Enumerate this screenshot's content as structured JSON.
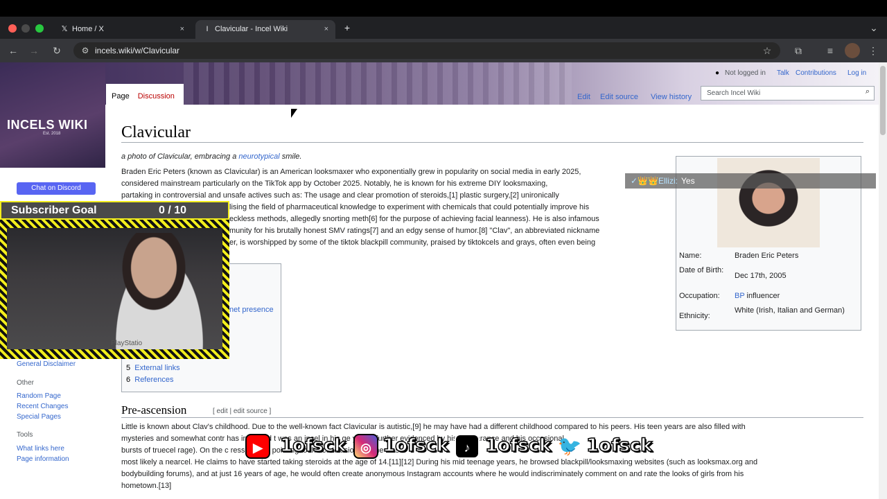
{
  "browser": {
    "tabs": [
      {
        "icon": "𝕏",
        "label": "Home / X",
        "close": "×"
      },
      {
        "icon": "I",
        "label": "Clavicular - Incel Wiki",
        "close": "×"
      }
    ],
    "new_tab": "+",
    "url": "incels.wiki/w/Clavicular",
    "toolbar_icons": {
      "back": "←",
      "forward": "→",
      "reload": "↻",
      "site_info": "⚙",
      "star": "☆",
      "extensions": "⧉",
      "media": "≡",
      "menu": "⋮",
      "tab_search": "⌄"
    }
  },
  "site": {
    "logo": "INCELS WIKI",
    "logo_sub": "Est. 2018",
    "discord": "Chat on Discord"
  },
  "page_tabs": {
    "page": "Page",
    "discussion": "Discussion"
  },
  "personal": {
    "not_logged_in": "Not logged in",
    "talk": "Talk",
    "contributions": "Contributions",
    "login": "Log in"
  },
  "views": {
    "edit": "Edit",
    "edit_source": "Edit source",
    "history": "View history"
  },
  "search": {
    "placeholder": "Search Incel Wiki",
    "icon": "⌕"
  },
  "article": {
    "title": "Clavicular",
    "caption": {
      "before": "a photo of Clavicular, embracing a ",
      "link": "neurotypical",
      "after": " smile."
    },
    "lines": [
      "Braden Eric Peters (known as Clavicular) is an American looksmaxer who exponentially grew in popularity on social media in early 2025,",
      "considered mainstream particularly on the TikTok app by October 2025. Notably, he is known for his extreme DIY looksmaxing,",
      "partaking in controversial and unsafe actives such as: The usage and clear promotion of steroids,[1] plastic surgery,[2] unironically",
      "lising the field of pharmaceutical knowledge to experiment with chemicals that could potentially improve his",
      "eckless methods, allegedly snorting meth[6] for the purpose of achieving facial leanness). He is also infamous",
      "munity for his brutally honest SMV ratings[7] and an edgy sense of humor.[8] \"Clav\", an abbreviated nickname",
      "er, is worshipped by some of the tiktok blackpill community, praised by tiktokcels and grays, often even being"
    ]
  },
  "infobox": {
    "rows": [
      {
        "label": "Name:",
        "value": "Braden Eric Peters"
      },
      {
        "label": "Date of Birth:",
        "value": "Dec 17th, 2005"
      },
      {
        "label": "Occupation:",
        "value_link": "BP",
        "value": " influencer"
      },
      {
        "label": "Ethnicity:",
        "value": "White (Irish, Italian and German)"
      }
    ]
  },
  "toc": {
    "partial": "net presence",
    "items": [
      {
        "num": "5",
        "label": "External links"
      },
      {
        "num": "6",
        "label": "References"
      }
    ]
  },
  "sidebar": {
    "disclaimer": "General Disclaimer",
    "other_heading": "Other",
    "other": [
      "Random Page",
      "Recent Changes",
      "Special Pages"
    ],
    "tools_heading": "Tools",
    "tools": [
      "What links here",
      "Page information"
    ]
  },
  "section": {
    "heading": "Pre-ascension",
    "edit": "[ edit | edit source ]",
    "lines": [
      "Little is known about Clav's childhood. Due to the well-known fact Clavicular is autistic,[9] he may have had a different childhood compared to his peers. His teen years are also filled with",
      "mysteries and somewhat contr                              has indicated t            was an incel in his         ge years (further evidenced by his appearance and his occasional",
      "bursts of truecel rage). On the c                                                                  ression,[10] pointing to the conclusion that he was",
      "most likely a nearcel. He claims to have started taking steroids at the age of 14.[11][12] During his mid teenage years, he browsed blackpill/looksmaxing websites (such as looksmax.org and",
      "bodybuilding forums), and at just 16 years of age, he would often create anonymous Instagram accounts where he would indiscriminately comment on and rate the looks of girls from his",
      "hometown.[13]"
    ]
  },
  "stream_overlay": {
    "subscriber_goal": "Subscriber Goal",
    "subscriber_count": "0 / 10",
    "webcam_brand": "PlayStatio",
    "chat": {
      "name": "✓👑👑Ellizi:",
      "message": "Yes"
    },
    "social_handle": "1ofsck",
    "social_icons": [
      "youtube-icon",
      "instagram-icon",
      "tiktok-icon",
      "twitter-icon"
    ],
    "social_glyphs": {
      "youtube": "▶",
      "instagram": "◎",
      "tiktok": "♪",
      "twitter": "🐦"
    }
  },
  "colors": {
    "link": "#3366cc",
    "discord": "#5865f2",
    "goal_border": "#f2ee1c"
  }
}
